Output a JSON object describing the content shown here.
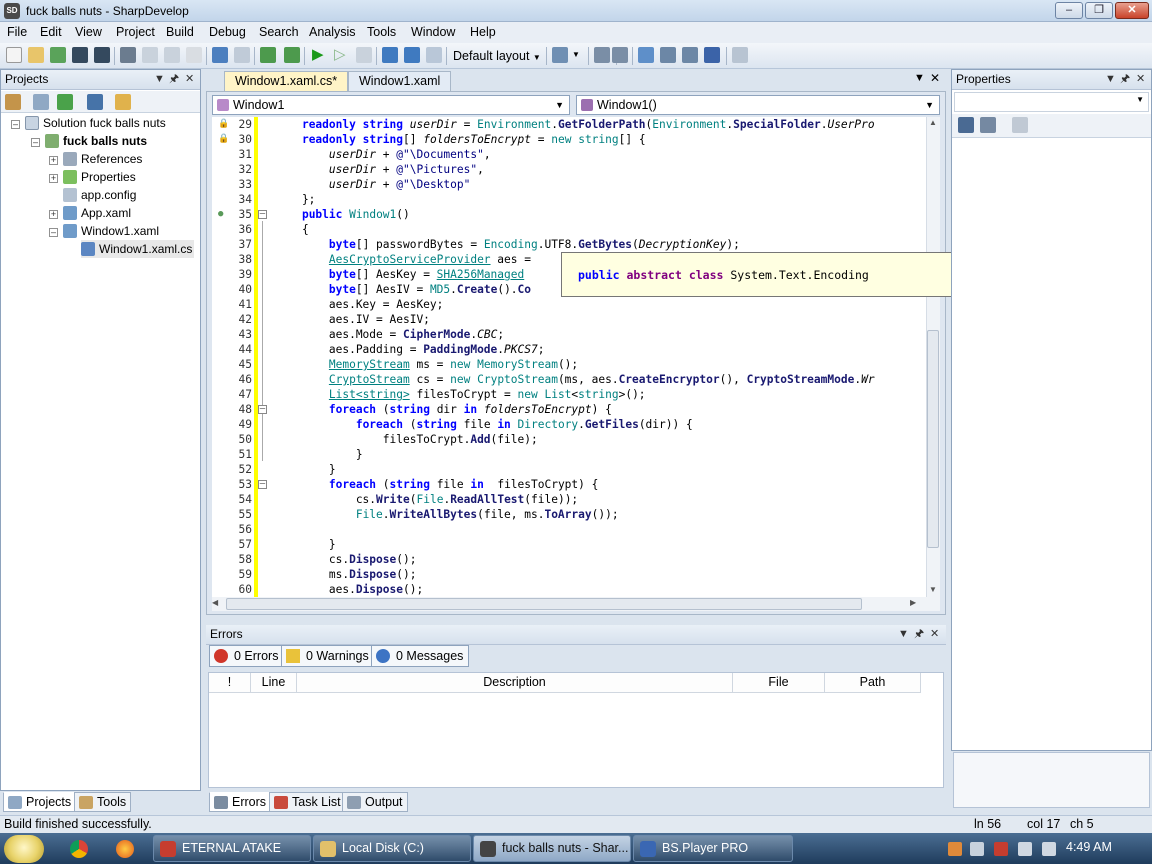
{
  "window": {
    "title": "fuck balls nuts - SharpDevelop",
    "icon_label": "SD"
  },
  "menu": [
    "File",
    "Edit",
    "View",
    "Project",
    "Build",
    "Debug",
    "Search",
    "Analysis",
    "Tools",
    "Window",
    "Help"
  ],
  "toolbar": {
    "layout_label": "Default layout"
  },
  "projects_panel": {
    "title": "Projects",
    "tree": [
      {
        "label": "Solution fuck balls nuts",
        "bold": false
      },
      {
        "label": "fuck balls nuts",
        "bold": true
      },
      {
        "label": "References"
      },
      {
        "label": "Properties"
      },
      {
        "label": "app.config"
      },
      {
        "label": "App.xaml"
      },
      {
        "label": "Window1.xaml"
      },
      {
        "label": "Window1.xaml.cs"
      }
    ],
    "tabs": [
      "Projects",
      "Tools"
    ]
  },
  "editor": {
    "tabs": [
      "Window1.xaml.cs*",
      "Window1.xaml"
    ],
    "class_combo": "Window1",
    "member_combo": "Window1()",
    "line_numbers": [
      29,
      30,
      31,
      32,
      33,
      34,
      35,
      36,
      37,
      38,
      39,
      40,
      41,
      42,
      43,
      44,
      45,
      46,
      47,
      48,
      49,
      50,
      51,
      52,
      53,
      54,
      55,
      56,
      57,
      58,
      59,
      60
    ],
    "tooltip": "public abstract class System.Text.Encoding"
  },
  "properties_panel": {
    "title": "Properties"
  },
  "errors_panel": {
    "title": "Errors",
    "errors_btn": "0 Errors",
    "warnings_btn": "0 Warnings",
    "messages_btn": "0 Messages",
    "columns": [
      "!",
      "Line",
      "Description",
      "File",
      "Path"
    ],
    "tabs": [
      "Errors",
      "Task List",
      "Output"
    ]
  },
  "status": {
    "message": "Build finished successfully.",
    "line": "ln 56",
    "col": "col 17",
    "ch": "ch 5"
  },
  "taskbar": {
    "items": [
      "ETERNAL ATAKE",
      "Local Disk (C:)",
      "fuck balls nuts - Shar...",
      "BS.Player PRO"
    ],
    "clock": "4:49 AM"
  }
}
